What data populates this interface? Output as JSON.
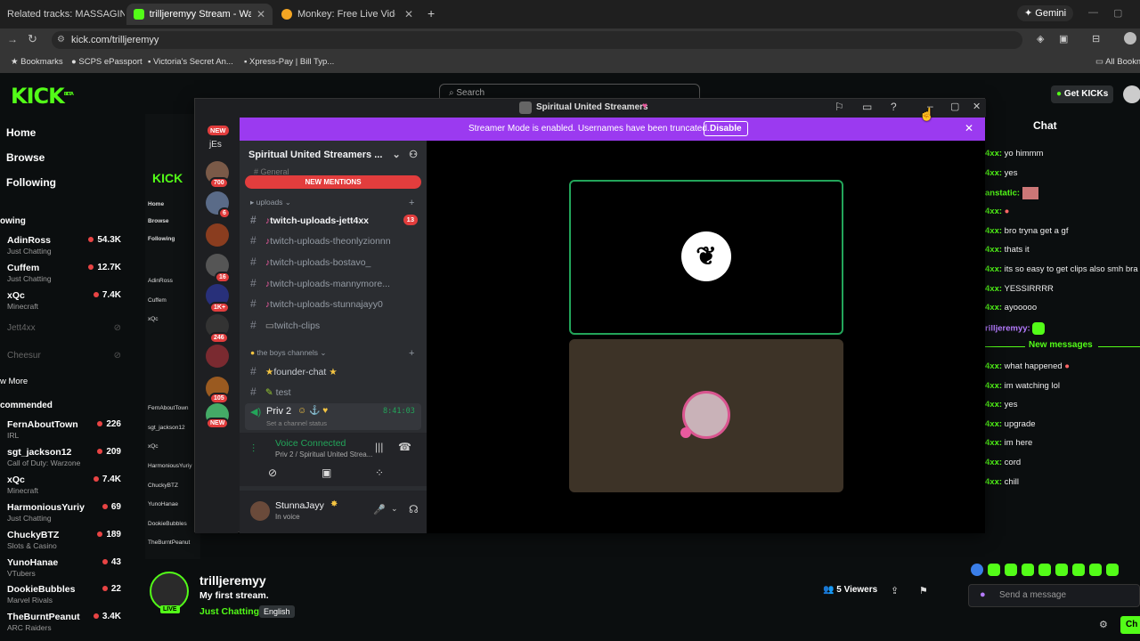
{
  "browser": {
    "tabs": [
      {
        "label": "Related tracks: MASSAGING ME",
        "color": "#e44"
      },
      {
        "label": "trilljeremyy Stream - Watch Live",
        "color": "#53fc18"
      },
      {
        "label": "Monkey: Free Live Video Chat",
        "color": "#f5a623"
      }
    ],
    "gemini_label": "Gemini",
    "url": "kick.com/trilljeremyy",
    "bookmarks": [
      "Bookmarks",
      "SCPS ePassport",
      "Victoria's Secret An...",
      "Xpress-Pay | Bill Typ..."
    ],
    "all_bookmarks": "All Bookm"
  },
  "kick": {
    "logo": "KICK",
    "logo_badge": "BETA",
    "search_placeholder": "Search",
    "get_kicks": "Get KICKs",
    "nav": [
      "Home",
      "Browse",
      "Following"
    ],
    "following_header": "owing",
    "following": [
      {
        "name": "AdinRoss",
        "sub": "Just Chatting",
        "viewers": "54.3K"
      },
      {
        "name": "Cuffem",
        "sub": "Just Chatting",
        "viewers": "12.7K"
      },
      {
        "name": "xQc",
        "sub": "Minecraft",
        "viewers": "7.4K"
      }
    ],
    "offline": [
      "Jett4xx",
      "Cheesur"
    ],
    "show_more": "w More",
    "recommended_header": "commended",
    "recommended": [
      {
        "name": "FernAboutTown",
        "sub": "IRL",
        "viewers": "226"
      },
      {
        "name": "sgt_jackson12",
        "sub": "Call of Duty: Warzone",
        "viewers": "209"
      },
      {
        "name": "xQc",
        "sub": "Minecraft",
        "viewers": "7.4K"
      },
      {
        "name": "HarmoniousYuriy",
        "sub": "Just Chatting",
        "viewers": "69"
      },
      {
        "name": "ChuckyBTZ",
        "sub": "Slots & Casino",
        "viewers": "189"
      },
      {
        "name": "YunoHanae",
        "sub": "VTubers",
        "viewers": "43"
      },
      {
        "name": "DookieBubbles",
        "sub": "Marvel Rivals",
        "viewers": "22"
      },
      {
        "name": "TheBurntPeanut",
        "sub": "ARC Raiders",
        "viewers": "3.4K"
      }
    ],
    "stream": {
      "streamer": "trilljeremyy",
      "title": "My first stream.",
      "category": "Just Chatting",
      "language": "English",
      "live_badge": "LIVE",
      "viewers": "5 Viewers"
    },
    "chat": {
      "title": "Chat",
      "messages": [
        {
          "user": "4xx:",
          "text": "yo himmm"
        },
        {
          "user": "4xx:",
          "text": "yes"
        },
        {
          "user": "anstatic:",
          "text": ""
        },
        {
          "user": "4xx:",
          "text": ""
        },
        {
          "user": "4xx:",
          "text": "bro tryna get a gf"
        },
        {
          "user": "4xx:",
          "text": "thats it"
        },
        {
          "user": "4xx:",
          "text": "its so easy to get clips also smh bra"
        },
        {
          "user": "4xx:",
          "text": "YESSIRRRR"
        },
        {
          "user": "4xx:",
          "text": "ayooooo"
        },
        {
          "user": "rilljeremyy:",
          "text": ""
        }
      ],
      "new_messages_label": "New messages",
      "new_messages": [
        {
          "user": "4xx:",
          "text": "what happened"
        },
        {
          "user": "4xx:",
          "text": "im watching lol"
        },
        {
          "user": "4xx:",
          "text": "yes"
        },
        {
          "user": "4xx:",
          "text": "upgrade"
        },
        {
          "user": "4xx:",
          "text": "im here"
        },
        {
          "user": "4xx:",
          "text": "cord"
        },
        {
          "user": "4xx:",
          "text": "chill"
        }
      ],
      "send_placeholder": "Send a message",
      "chat_button": "Ch"
    }
  },
  "discord": {
    "window_title": "Spiritual United Streamers",
    "banner_text": "Streamer Mode is enabled. Usernames have been truncated.",
    "banner_button": "Disable",
    "server_name": "Spiritual United Streamers ...",
    "new_mentions": "NEW MENTIONS",
    "hidden_channel": "General",
    "guild_badges": [
      "NEW",
      "jEs",
      "700",
      "6",
      "16",
      "1K+",
      "246",
      "105",
      "NEW"
    ],
    "uploads_category": "uploads",
    "channels": [
      {
        "name": "twitch-uploads-jett4xx",
        "unread": true,
        "badge": "13"
      },
      {
        "name": "twitch-uploads-theonlyzionnn",
        "unread": false
      },
      {
        "name": "twitch-uploads-bostavo_",
        "unread": false
      },
      {
        "name": "twitch-uploads-mannymore...",
        "unread": false
      },
      {
        "name": "twitch-uploads-stunnajayy0",
        "unread": false
      },
      {
        "name": "twitch-clips",
        "unread": false
      }
    ],
    "boys_category": "the boys channels",
    "channels2": [
      {
        "name": "founder-chat",
        "unread": false
      },
      {
        "name": "test",
        "unread": false
      }
    ],
    "voice_channel": "Priv 2",
    "voice_channel_time": "8:41:03",
    "voice_channel_status": "Set a channel status",
    "voice_connected": "Voice Connected",
    "voice_location": "Priv 2 / Spiritual United Strea...",
    "user_name": "StunnaJayy",
    "user_status": "In voice"
  }
}
